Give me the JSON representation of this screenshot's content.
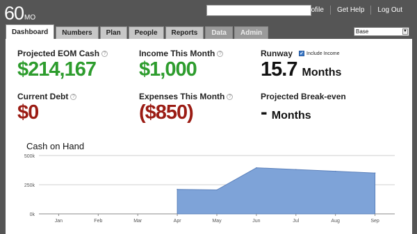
{
  "logo": {
    "big": "60",
    "small": "MO"
  },
  "search": {
    "value": ""
  },
  "toplinks": [
    "Your Profile",
    "Get Help",
    "Log Out"
  ],
  "tabs": [
    {
      "label": "Dashboard",
      "state": "active"
    },
    {
      "label": "Numbers",
      "state": "normal"
    },
    {
      "label": "Plan",
      "state": "normal"
    },
    {
      "label": "People",
      "state": "normal"
    },
    {
      "label": "Reports",
      "state": "normal"
    },
    {
      "label": "Data",
      "state": "disabled"
    },
    {
      "label": "Admin",
      "state": "disabled"
    }
  ],
  "scenario_select": {
    "value": "Base"
  },
  "metrics": {
    "eom_cash": {
      "label": "Projected EOM Cash",
      "value": "$214,167"
    },
    "income": {
      "label": "Income This Month",
      "value": "$1,000"
    },
    "runway": {
      "label": "Runway",
      "value": "15.7",
      "units": "Months",
      "checkbox_label": "Include Income",
      "checked": true
    },
    "debt": {
      "label": "Current Debt",
      "value": "$0"
    },
    "expenses": {
      "label": "Expenses This Month",
      "value": "($850)"
    },
    "breakeven": {
      "label": "Projected Break-even",
      "value": "-",
      "units": "Months"
    }
  },
  "icons": {
    "help": "help-icon",
    "checkbox": "checkbox-icon",
    "dropdown": "chevron-down-icon"
  },
  "colors": {
    "positive": "#2d9c2d",
    "negative": "#9b1c14",
    "area_fill": "#7ea3d8",
    "area_stroke": "#5b80bb"
  },
  "chart_data": {
    "type": "area",
    "title": "Cash on Hand",
    "categories": [
      "Jan",
      "Feb",
      "Mar",
      "Apr",
      "May",
      "Jun",
      "Jul",
      "Aug",
      "Sep"
    ],
    "series": [
      {
        "values": [
          null,
          null,
          null,
          210000,
          205000,
          395000,
          380000,
          365000,
          350000
        ]
      }
    ],
    "y_ticks": [
      "0k",
      "250k",
      "500k"
    ],
    "ylim": [
      0,
      500000
    ],
    "grid": true
  }
}
